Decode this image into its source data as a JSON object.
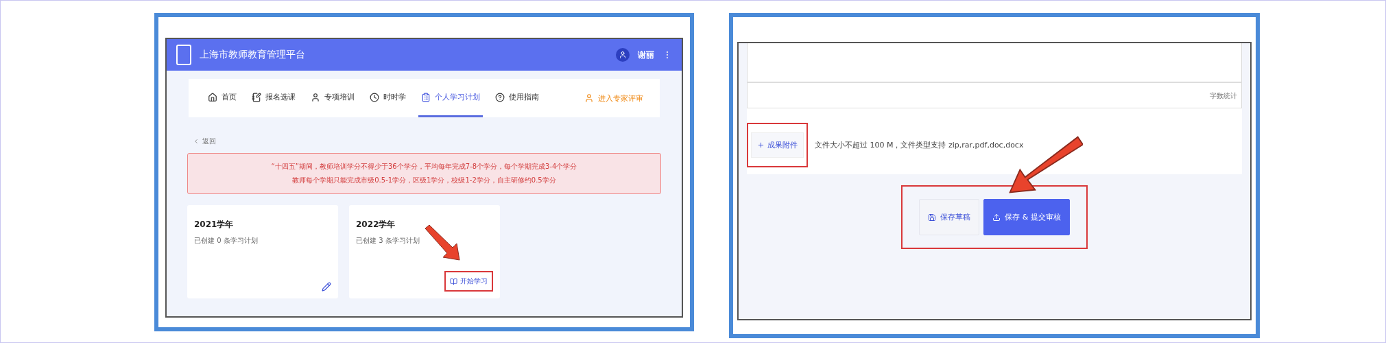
{
  "left_screenshot": {
    "header": {
      "title": "上海市教师教育管理平台",
      "user": "谢丽"
    },
    "nav": [
      {
        "label": "首页",
        "selected": false
      },
      {
        "label": "报名选课",
        "selected": false
      },
      {
        "label": "专项培训",
        "selected": false
      },
      {
        "label": "时时学",
        "selected": false
      },
      {
        "label": "个人学习计划",
        "selected": true
      },
      {
        "label": "使用指南",
        "selected": false
      }
    ],
    "expert_link": "进入专家评审",
    "back": "返回",
    "notice": [
      "“十四五”期间，教师培训学分不得少于36个学分，平均每年完成7-8个学分，每个学期完成3-4个学分",
      "教师每个学期只能完成市级0.5-1学分，区级1学分，校级1-2学分，自主研修约0.5学分"
    ],
    "plan_cards": [
      {
        "year": "2021学年",
        "summary": "已创建 0 条学习计划",
        "kind": "edit"
      },
      {
        "year": "2022学年",
        "summary": "已创建 3 条学习计划",
        "kind": "start",
        "action": "开始学习"
      }
    ]
  },
  "right_screenshot": {
    "counter_placeholder": "字数统计",
    "upload_button": "成果附件",
    "upload_hint": "文件大小不超过 100 M，文件类型支持 zip,rar,pdf,doc,docx",
    "buttons": [
      {
        "label": "保存草稿",
        "kind": "secondary"
      },
      {
        "label": "保存 & 提交审核",
        "kind": "primary"
      }
    ]
  }
}
